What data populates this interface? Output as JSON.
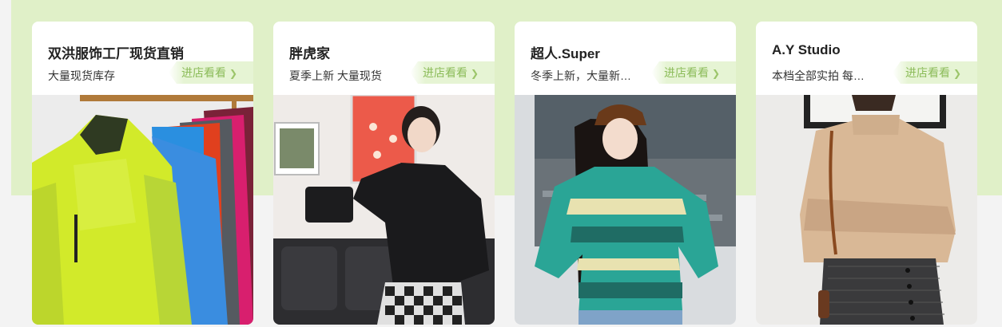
{
  "shops": [
    {
      "name": "双洪服饰工厂现货直销",
      "desc": "大量现货库存",
      "enter_label": "进店看看",
      "image": "jackets-on-rack-photo"
    },
    {
      "name": "胖虎家",
      "desc": "夏季上新 大量现货",
      "enter_label": "进店看看",
      "image": "woman-black-top-photo"
    },
    {
      "name": "超人.Super",
      "desc": "冬季上新，大量新…",
      "enter_label": "进店看看",
      "image": "woman-teal-sweater-photo"
    },
    {
      "name": "A.Y Studio",
      "desc": "本档全部实拍 每…",
      "enter_label": "进店看看",
      "image": "woman-beige-turtleneck-photo"
    }
  ],
  "colors": {
    "band": "#e0f0c8",
    "enter_bg": "#e6f4d4",
    "enter_text": "#8cbc5a"
  },
  "icons": {
    "enter": "chevron-right-icon"
  }
}
